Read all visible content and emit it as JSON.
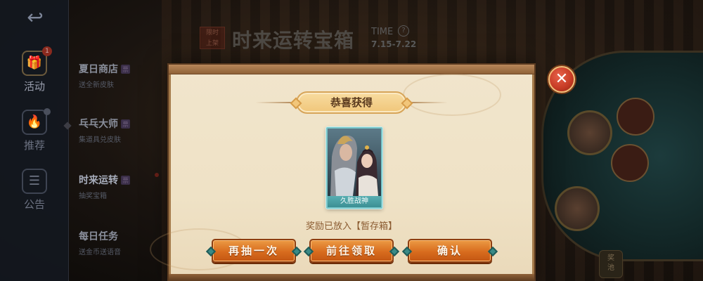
{
  "sidebar": {
    "back_glyph": "↩",
    "items": [
      {
        "label": "活动",
        "icon": "gift-icon",
        "glyph": "🎁",
        "badge": "1"
      },
      {
        "label": "推荐",
        "icon": "flame-icon",
        "glyph": "🔥"
      },
      {
        "label": "公告",
        "icon": "notice-icon",
        "glyph": "☰"
      }
    ]
  },
  "menu": {
    "items": [
      {
        "title": "夏日商店",
        "tag": "票",
        "subtitle": "送全新皮肤"
      },
      {
        "title": "乓乓大师",
        "tag": "票",
        "subtitle": "集道具兑皮肤"
      },
      {
        "title": "时来运转",
        "tag": "票",
        "subtitle": "抽奖宝箱"
      },
      {
        "title": "每日任务",
        "subtitle": "送金币送语音"
      }
    ]
  },
  "event": {
    "seal_line1": "限时",
    "seal_line2": "上架",
    "title": "时来运转宝箱",
    "time_label": "TIME",
    "help_glyph": "?",
    "dates": "7.15-7.22"
  },
  "wheel": {
    "record_line1": "奖",
    "record_line2": "池"
  },
  "modal": {
    "header": "恭喜获得",
    "reward_name": "久胜战神",
    "note": "奖励已放入【暂存箱】",
    "close_glyph": "✕",
    "buttons": {
      "draw_again": "再抽一次",
      "go_claim": "前往领取",
      "confirm": "确认"
    }
  },
  "colors": {
    "accent_orange": "#d86c1e",
    "card_teal": "#58aeb2",
    "close_red": "#c53a24"
  }
}
